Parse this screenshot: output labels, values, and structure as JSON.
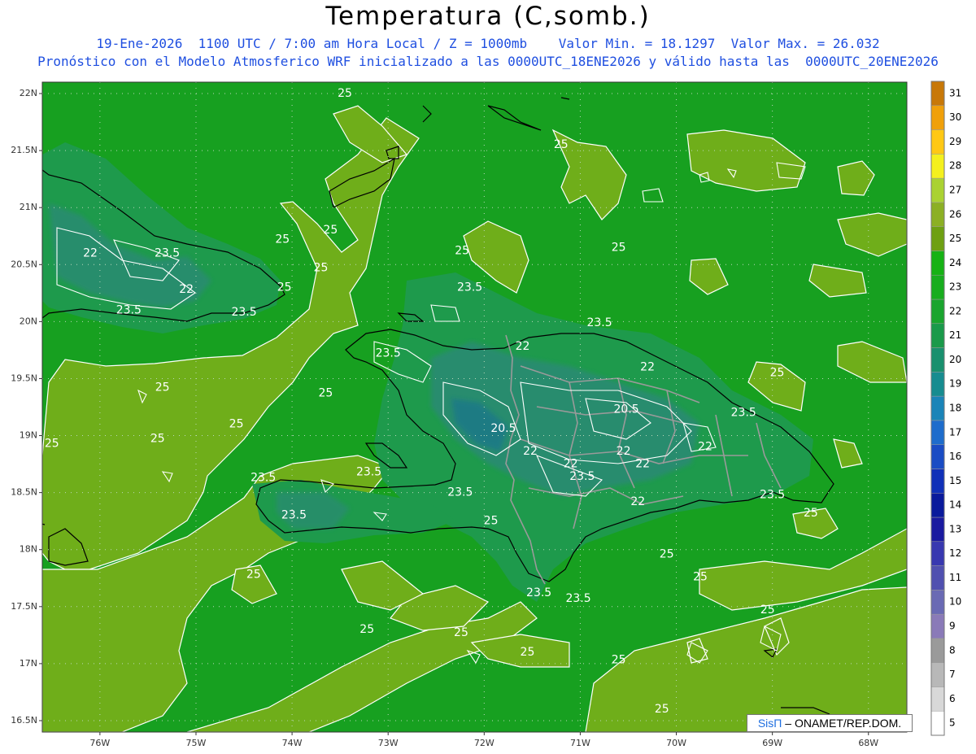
{
  "title": "Temperatura (C,somb.)",
  "subtitle1": "19-Ene-2026  1100 UTC / 7:00 am Hora Local / Z = 1000mb    Valor Min. = 18.1297  Valor Max. = 26.032",
  "subtitle2": "Pronóstico con el Modelo Atmosferico WRF inicializado a las 0000UTC_18ENE2026 y válido hasta las  0000UTC_20ENE2026",
  "watermark": {
    "logo": "SisΠ",
    "text": "– ONAMET/REP.DOM."
  },
  "map": {
    "lat_labels": [
      "22N",
      "21.5N",
      "21N",
      "20.5N",
      "20N",
      "19.5N",
      "19N",
      "18.5N",
      "18N",
      "17.5N",
      "17N",
      "16.5N"
    ],
    "lon_labels": [
      "76W",
      "75W",
      "74W",
      "73W",
      "72W",
      "71W",
      "70W",
      "69W",
      "68W"
    ],
    "lon_range": [
      -76.6,
      -67.6
    ],
    "lat_range": [
      16.4,
      22.1
    ],
    "colors": {
      "low": "#2a8a74",
      "mid": "#17a020",
      "warm": "#6fae1a",
      "contour": "#ffffff",
      "coast": "#000000",
      "border": "#9a9a9a"
    },
    "contour_labels": [
      {
        "text": "25",
        "lon": -73.45,
        "lat": 22.0
      },
      {
        "text": "25",
        "lon": -71.2,
        "lat": 21.55
      },
      {
        "text": "25",
        "lon": -73.6,
        "lat": 20.8
      },
      {
        "text": "25",
        "lon": -74.1,
        "lat": 20.72
      },
      {
        "text": "25",
        "lon": -72.23,
        "lat": 20.62
      },
      {
        "text": "25",
        "lon": -70.6,
        "lat": 20.65
      },
      {
        "text": "25",
        "lon": -73.7,
        "lat": 20.47
      },
      {
        "text": "25",
        "lon": -74.08,
        "lat": 20.3
      },
      {
        "text": "22",
        "lon": -76.1,
        "lat": 20.6
      },
      {
        "text": "23.5",
        "lon": -75.3,
        "lat": 20.6
      },
      {
        "text": "22",
        "lon": -75.1,
        "lat": 20.28
      },
      {
        "text": "23.5",
        "lon": -75.7,
        "lat": 20.1
      },
      {
        "text": "23.5",
        "lon": -74.5,
        "lat": 20.08
      },
      {
        "text": "23.5",
        "lon": -72.15,
        "lat": 20.3
      },
      {
        "text": "23.5",
        "lon": -70.8,
        "lat": 19.99
      },
      {
        "text": "22",
        "lon": -71.6,
        "lat": 19.78
      },
      {
        "text": "23.5",
        "lon": -73.0,
        "lat": 19.72
      },
      {
        "text": "22",
        "lon": -70.3,
        "lat": 19.6
      },
      {
        "text": "25",
        "lon": -68.95,
        "lat": 19.55
      },
      {
        "text": "25",
        "lon": -75.35,
        "lat": 19.42
      },
      {
        "text": "25",
        "lon": -73.65,
        "lat": 19.37
      },
      {
        "text": "20.5",
        "lon": -70.52,
        "lat": 19.23
      },
      {
        "text": "23.5",
        "lon": -69.3,
        "lat": 19.2
      },
      {
        "text": "25",
        "lon": -74.58,
        "lat": 19.1
      },
      {
        "text": "20.5",
        "lon": -71.8,
        "lat": 19.06
      },
      {
        "text": "25",
        "lon": -75.4,
        "lat": 18.97
      },
      {
        "text": "25",
        "lon": -76.5,
        "lat": 18.93
      },
      {
        "text": "22",
        "lon": -71.52,
        "lat": 18.86
      },
      {
        "text": "22",
        "lon": -70.55,
        "lat": 18.86
      },
      {
        "text": "22",
        "lon": -69.7,
        "lat": 18.9
      },
      {
        "text": "22",
        "lon": -71.1,
        "lat": 18.75
      },
      {
        "text": "22",
        "lon": -70.35,
        "lat": 18.75
      },
      {
        "text": "23.5",
        "lon": -73.2,
        "lat": 18.68
      },
      {
        "text": "23.5",
        "lon": -74.3,
        "lat": 18.63
      },
      {
        "text": "23.5",
        "lon": -70.98,
        "lat": 18.64
      },
      {
        "text": "23.5",
        "lon": -72.25,
        "lat": 18.5
      },
      {
        "text": "23.5",
        "lon": -69.0,
        "lat": 18.48
      },
      {
        "text": "22",
        "lon": -70.4,
        "lat": 18.42
      },
      {
        "text": "23.5",
        "lon": -73.98,
        "lat": 18.3
      },
      {
        "text": "25",
        "lon": -71.93,
        "lat": 18.25
      },
      {
        "text": "25",
        "lon": -68.6,
        "lat": 18.32
      },
      {
        "text": "25",
        "lon": -70.1,
        "lat": 17.96
      },
      {
        "text": "25",
        "lon": -74.4,
        "lat": 17.78
      },
      {
        "text": "25",
        "lon": -69.75,
        "lat": 17.76
      },
      {
        "text": "23.5",
        "lon": -71.43,
        "lat": 17.62
      },
      {
        "text": "23.5",
        "lon": -71.02,
        "lat": 17.57
      },
      {
        "text": "25",
        "lon": -69.05,
        "lat": 17.47
      },
      {
        "text": "25",
        "lon": -73.22,
        "lat": 17.3
      },
      {
        "text": "25",
        "lon": -72.24,
        "lat": 17.27
      },
      {
        "text": "25",
        "lon": -71.55,
        "lat": 17.1
      },
      {
        "text": "25",
        "lon": -70.6,
        "lat": 17.03
      },
      {
        "text": "25",
        "lon": -70.15,
        "lat": 16.6
      }
    ]
  },
  "colorbar": {
    "levels": [
      "5",
      "6",
      "7",
      "8",
      "9",
      "10",
      "11",
      "12",
      "13",
      "14",
      "15",
      "16",
      "17",
      "18",
      "19",
      "20",
      "21",
      "22",
      "23",
      "24",
      "25",
      "26",
      "27",
      "28",
      "29",
      "30",
      "31"
    ],
    "colors": [
      "#ffffff",
      "#d8d8d8",
      "#b8b8b8",
      "#9a9a9a",
      "#8a7ab8",
      "#6a6ab4",
      "#5050b0",
      "#3838b0",
      "#1a1aa0",
      "#0a1a9c",
      "#1030b8",
      "#1a4cc4",
      "#1e6ccc",
      "#1a84b8",
      "#178c90",
      "#19906e",
      "#1a9a4a",
      "#1aa52e",
      "#18ad1e",
      "#16b214",
      "#6ea012",
      "#8cb024",
      "#aad232",
      "#f4f01e",
      "#ffc814",
      "#f0a00a",
      "#c87808"
    ]
  }
}
